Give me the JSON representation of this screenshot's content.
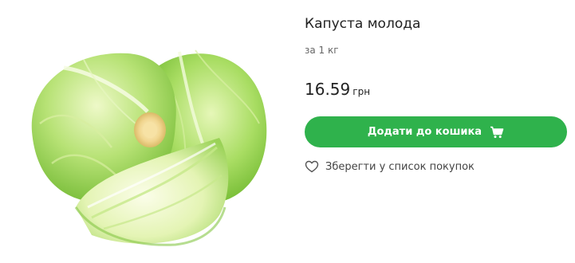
{
  "product": {
    "title": "Капуста молода",
    "unit": "за 1 кг",
    "price": "16.59",
    "currency": "грн",
    "image_icon": "cabbage-image"
  },
  "actions": {
    "add_to_cart_label": "Додати до кошика",
    "add_to_cart_icon": "cart-icon",
    "save_label": "Зберегти у список покупок",
    "save_icon": "heart-outline-icon"
  },
  "colors": {
    "accent": "#2fb24c",
    "button_text": "#ffffff",
    "text_primary": "#222222",
    "text_secondary": "#666666"
  }
}
